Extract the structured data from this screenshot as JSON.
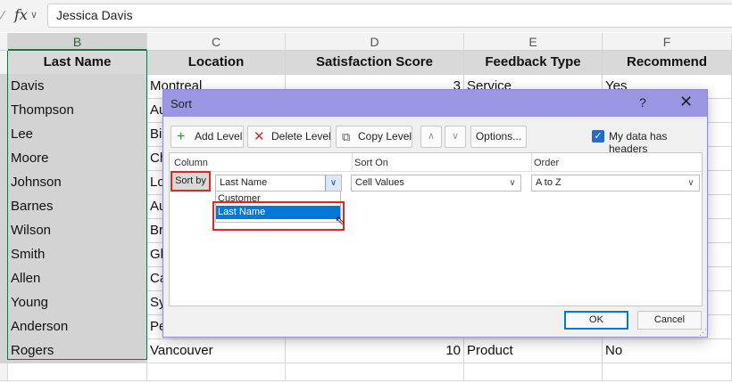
{
  "formula_bar": {
    "fx": "fx",
    "value": "Jessica Davis"
  },
  "columns": {
    "B": "B",
    "C": "C",
    "D": "D",
    "E": "E",
    "F": "F"
  },
  "table": {
    "headers": [
      "Last Name",
      "Location",
      "Satisfaction Score",
      "Feedback Type",
      "Recommend"
    ],
    "rows": [
      [
        "Davis",
        "Montreal",
        "3",
        "Service",
        "Yes"
      ],
      [
        "Thompson",
        "Au",
        "",
        "",
        ""
      ],
      [
        "Lee",
        "Bi",
        "",
        "",
        ""
      ],
      [
        "Moore",
        "Ch",
        "",
        "",
        ""
      ],
      [
        "Johnson",
        "Lo",
        "",
        "",
        ""
      ],
      [
        "Barnes",
        "Au",
        "",
        "",
        ""
      ],
      [
        "Wilson",
        "Br",
        "",
        "",
        ""
      ],
      [
        "Smith",
        "Gl",
        "",
        "",
        ""
      ],
      [
        "Allen",
        "Ca",
        "",
        "",
        ""
      ],
      [
        "Young",
        "Sy",
        "",
        "",
        ""
      ],
      [
        "Anderson",
        "Pe",
        "",
        "",
        ""
      ],
      [
        "Rogers",
        "Vancouver",
        "10",
        "Product",
        "No"
      ]
    ]
  },
  "dialog": {
    "title": "Sort",
    "help": "?",
    "close": "✕",
    "add_level": "Add Level",
    "delete_level": "Delete Level",
    "copy_level": "Copy Level",
    "options": "Options...",
    "headers_checkbox": "My data has headers",
    "headers_checked": true,
    "col_column": "Column",
    "col_sort_on": "Sort On",
    "col_order": "Order",
    "sort_by": "Sort by",
    "column_value": "Last Name",
    "sort_on_value": "Cell Values",
    "order_value": "A to Z",
    "dropdown_options": [
      "Customer",
      "Last Name"
    ],
    "ok": "OK",
    "cancel": "Cancel"
  }
}
